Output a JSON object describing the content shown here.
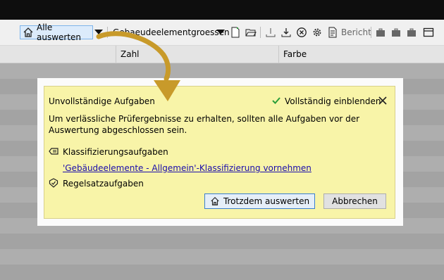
{
  "toolbar": {
    "evaluate_all_label": "Alle auswerten",
    "groups_label": "Gebaeudeelementgroessen",
    "report_label": "Bericht"
  },
  "table": {
    "columns": [
      "Zahl",
      "Farbe"
    ]
  },
  "dialog": {
    "title": "Unvollständige Aufgaben",
    "show_all_label": "Vollständig einblenden",
    "message": "Um verlässliche Prüfergebnisse zu erhalten, sollten alle Aufgaben vor der Auswertung abgeschlossen sein.",
    "classification_heading": "Klassifizierungsaufgaben",
    "classification_link": "'Gebäudeelemente - Allgemein'-Klassifizierung vornehmen",
    "ruleset_heading": "Regelsatzaufgaben",
    "evaluate_anyway_label": "Trotzdem auswerten",
    "cancel_label": "Abbrechen"
  },
  "colors": {
    "panel_background": "#f8f4a8",
    "accent_arrow": "#c89a2a",
    "link": "#1a0dab",
    "check": "#2a9d3a"
  }
}
